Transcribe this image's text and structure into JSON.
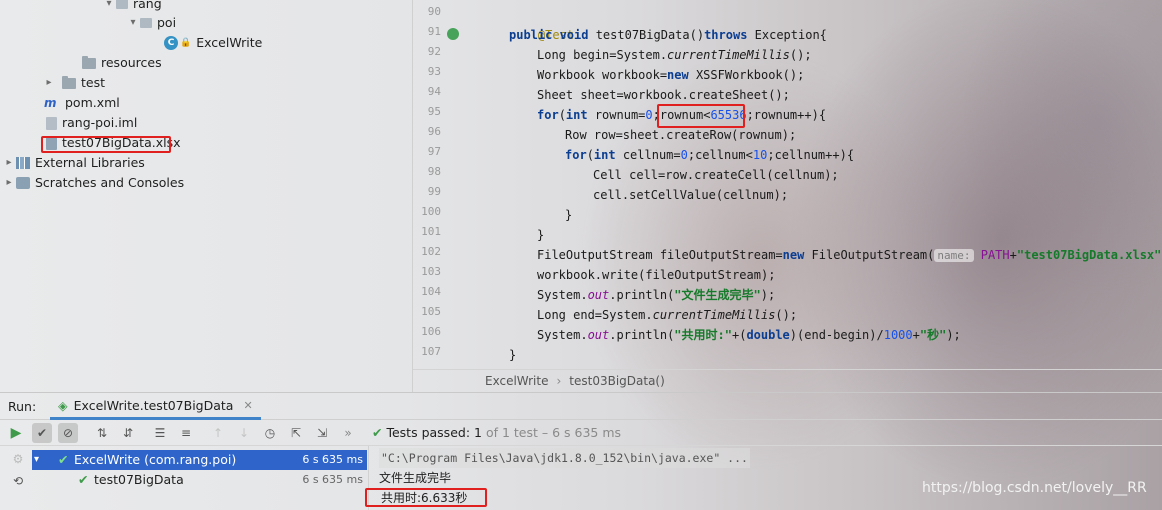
{
  "project_tree": {
    "items": [
      {
        "label": "rang",
        "kind": "package",
        "expanded": true
      },
      {
        "label": "poi",
        "kind": "package",
        "expanded": true
      },
      {
        "label": "ExcelWrite",
        "kind": "class"
      },
      {
        "label": "resources",
        "kind": "folder"
      },
      {
        "label": "test",
        "kind": "folder",
        "expanded": false
      },
      {
        "label": "pom.xml",
        "kind": "maven"
      },
      {
        "label": "rang-poi.iml",
        "kind": "file"
      },
      {
        "label": "test07BigData.xlsx",
        "kind": "xlsx",
        "highlighted": true
      },
      {
        "label": "External Libraries",
        "kind": "libraries",
        "expanded": false
      },
      {
        "label": "Scratches and Consoles",
        "kind": "scratches",
        "expanded": false
      }
    ]
  },
  "editor": {
    "line_numbers": [
      "90",
      "91",
      "92",
      "93",
      "94",
      "95",
      "96",
      "97",
      "98",
      "99",
      "100",
      "101",
      "102",
      "103",
      "104",
      "105",
      "106",
      "107"
    ],
    "code": {
      "l90_annotation": "@Test",
      "l91_a": "public void ",
      "l91_b": "test07BigData()",
      "l91_c": "throws ",
      "l91_d": "Exception{",
      "l92_a": "Long begin=System.",
      "l92_b": "currentTimeMillis",
      "l92_c": "();",
      "l93_a": "Workbook workbook=",
      "l93_b": "new ",
      "l93_c": "XSSFWorkbook();",
      "l94": "Sheet sheet=workbook.createSheet();",
      "l95_a": "for",
      "l95_b": "(",
      "l95_c": "int ",
      "l95_d": "rownum=",
      "l95_e": "0",
      "l95_f": ";",
      "l95_g": "rownum<",
      "l95_h": "65536",
      "l95_i": ";rownum++){",
      "l96": "Row row=sheet.createRow(rownum);",
      "l97_a": "for",
      "l97_b": "(",
      "l97_c": "int ",
      "l97_d": "cellnum=",
      "l97_e": "0",
      "l97_f": ";cellnum<",
      "l97_g": "10",
      "l97_h": ";cellnum++){",
      "l98": "Cell cell=row.createCell(cellnum);",
      "l99": "cell.setCellValue(cellnum);",
      "l100": "}",
      "l101": "}",
      "l102_a": "FileOutputStream fileOutputStream=",
      "l102_b": "new ",
      "l102_c": "FileOutputStream(",
      "l102_hint": "name:",
      "l102_d": "PATH",
      "l102_e": "+",
      "l102_f": "\"test07BigData.xlsx\"",
      "l102_g": ");",
      "l103": "workbook.write(fileOutputStream);",
      "l104_a": "System.",
      "l104_b": "out",
      "l104_c": ".println(",
      "l104_d": "\"文件生成完毕\"",
      "l104_e": ");",
      "l105_a": "Long end=System.",
      "l105_b": "currentTimeMillis",
      "l105_c": "();",
      "l106_a": "System.",
      "l106_b": "out",
      "l106_c": ".println(",
      "l106_d": "\"共用时:\"",
      "l106_e": "+(",
      "l106_f": "double",
      "l106_g": ")(end-begin)/",
      "l106_h": "1000",
      "l106_i": "+",
      "l106_j": "\"秒\"",
      "l106_k": ");",
      "l107": "}"
    },
    "breadcrumb": [
      "ExcelWrite",
      "test03BigData()"
    ]
  },
  "run_panel": {
    "header_label": "Run:",
    "tab_label": "ExcelWrite.test07BigData",
    "status": {
      "passed": "Tests passed: 1",
      "detail": "of 1 test – 6 s 635 ms"
    },
    "tests": [
      {
        "label": "ExcelWrite (com.rang.poi)",
        "time": "6 s 635 ms"
      },
      {
        "label": "test07BigData",
        "time": "6 s 635 ms"
      }
    ],
    "console": [
      "\"C:\\Program Files\\Java\\jdk1.8.0_152\\bin\\java.exe\" ...",
      "文件生成完毕",
      "共用时:6.633秒"
    ]
  },
  "watermark": "https://blog.csdn.net/lovely__RR",
  "colors": {
    "highlight_box": "#e0201e",
    "selection": "#2f65ca",
    "pass_green": "#3f9b4b"
  }
}
